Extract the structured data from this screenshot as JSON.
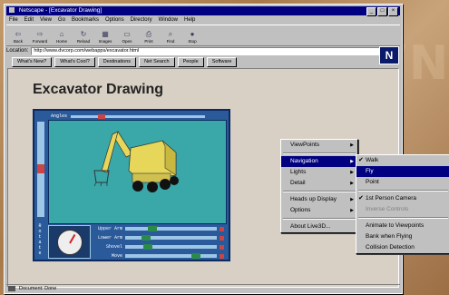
{
  "window": {
    "title": "Netscape - [Excavator Drawing]",
    "minimize": "_",
    "maximize": "□",
    "close": "×"
  },
  "menubar": [
    "File",
    "Edit",
    "View",
    "Go",
    "Bookmarks",
    "Options",
    "Directory",
    "Window",
    "Help"
  ],
  "toolbar": [
    {
      "label": "Back",
      "icon": "back-arrow-icon",
      "glyph": "⇦"
    },
    {
      "label": "Forward",
      "icon": "forward-arrow-icon",
      "glyph": "⇨"
    },
    {
      "label": "Home",
      "icon": "home-icon",
      "glyph": "⌂"
    },
    {
      "label": "Reload",
      "icon": "reload-icon",
      "glyph": "↻"
    },
    {
      "label": "Images",
      "icon": "images-icon",
      "glyph": "▦"
    },
    {
      "label": "Open",
      "icon": "open-icon",
      "glyph": "▭"
    },
    {
      "label": "Print",
      "icon": "print-icon",
      "glyph": "⎙"
    },
    {
      "label": "Find",
      "icon": "find-icon",
      "glyph": "⌕"
    },
    {
      "label": "Stop",
      "icon": "stop-icon",
      "glyph": "●"
    }
  ],
  "location": {
    "label": "Location:",
    "url": "http://www.dvcorp.com/webapps/excavator.html"
  },
  "directory_buttons": [
    "What's New?",
    "What's Cool?",
    "Destinations",
    "Net Search",
    "People",
    "Software"
  ],
  "page": {
    "heading": "Excavator Drawing"
  },
  "viewer": {
    "angles_label": "Angles",
    "side_label": "Rotate",
    "controls": [
      "Upper Arm",
      "Lower Arm",
      "Shovel",
      "Move"
    ],
    "knob_positions": [
      0.25,
      0.18,
      0.2,
      0.72
    ]
  },
  "context_menu": {
    "items": [
      {
        "label": "ViewPoints",
        "submenu": true
      },
      {
        "label": "Navigation",
        "submenu": true,
        "selected": true
      },
      {
        "label": "Lights",
        "submenu": true
      },
      {
        "label": "Detail",
        "submenu": true
      },
      {
        "label": "Heads up Display",
        "submenu": true
      },
      {
        "label": "Options",
        "submenu": true
      },
      {
        "label": "About Live3D...",
        "submenu": false
      }
    ]
  },
  "navigation_submenu": {
    "items": [
      {
        "label": "Walk",
        "checked": true
      },
      {
        "label": "Fly",
        "selected": true
      },
      {
        "label": "Point"
      },
      {
        "label": "1st Person Camera",
        "checked": true
      },
      {
        "label": "Inverse Controls",
        "disabled": true
      },
      {
        "label": "Animate to Viewpoints"
      },
      {
        "label": "Bank when Flying"
      },
      {
        "label": "Collision Detection"
      }
    ]
  },
  "status": {
    "text": "Document: Done"
  },
  "colors": {
    "titlebar": "#000080",
    "viewer_frame": "#2a5a9a",
    "viewport": "#3aa8a8",
    "excavator_body": "#e6d65a"
  }
}
